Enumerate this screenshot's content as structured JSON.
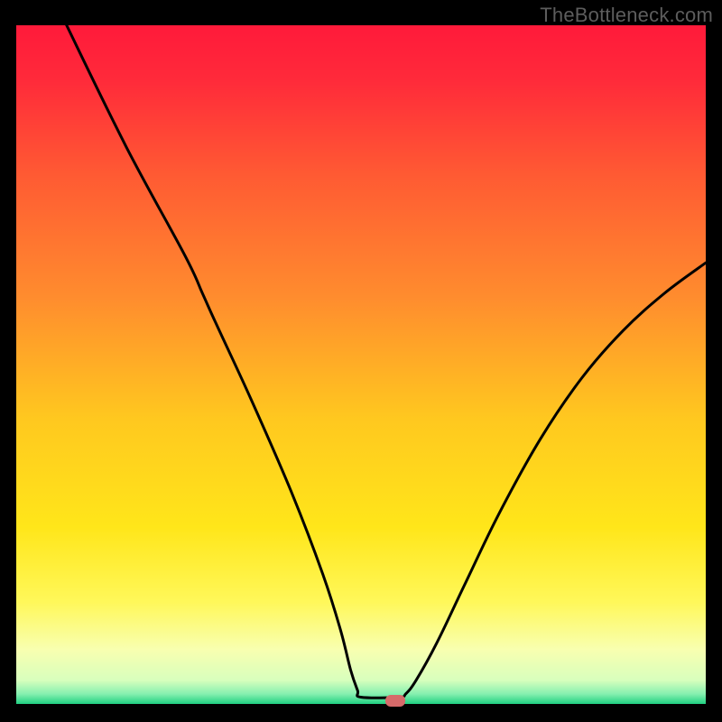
{
  "watermark": "TheBottleneck.com",
  "chart_data": {
    "type": "line",
    "title": "",
    "xlabel": "",
    "ylabel": "",
    "xlim": [
      0,
      100
    ],
    "ylim": [
      0,
      100
    ],
    "gradient_stops": [
      {
        "offset": 0.0,
        "color": "#ff1a3a"
      },
      {
        "offset": 0.08,
        "color": "#ff2a3a"
      },
      {
        "offset": 0.22,
        "color": "#ff5a33"
      },
      {
        "offset": 0.4,
        "color": "#ff8c2e"
      },
      {
        "offset": 0.58,
        "color": "#ffc81f"
      },
      {
        "offset": 0.74,
        "color": "#ffe61a"
      },
      {
        "offset": 0.85,
        "color": "#fff85a"
      },
      {
        "offset": 0.92,
        "color": "#f8ffb0"
      },
      {
        "offset": 0.965,
        "color": "#d8ffbd"
      },
      {
        "offset": 0.985,
        "color": "#87f0b0"
      },
      {
        "offset": 1.0,
        "color": "#20d082"
      }
    ],
    "series": [
      {
        "name": "bottleneck-curve",
        "points": [
          {
            "x": 7.3,
            "y": 100.0
          },
          {
            "x": 16.0,
            "y": 82.0
          },
          {
            "x": 24.5,
            "y": 66.0
          },
          {
            "x": 27.0,
            "y": 60.5
          },
          {
            "x": 29.0,
            "y": 56.0
          },
          {
            "x": 34.0,
            "y": 45.0
          },
          {
            "x": 40.0,
            "y": 31.0
          },
          {
            "x": 44.5,
            "y": 19.0
          },
          {
            "x": 47.0,
            "y": 11.0
          },
          {
            "x": 48.5,
            "y": 5.0
          },
          {
            "x": 49.5,
            "y": 2.0
          },
          {
            "x": 50.0,
            "y": 1.0
          },
          {
            "x": 55.5,
            "y": 1.0
          },
          {
            "x": 56.5,
            "y": 1.5
          },
          {
            "x": 58.0,
            "y": 3.5
          },
          {
            "x": 61.0,
            "y": 9.0
          },
          {
            "x": 65.0,
            "y": 17.5
          },
          {
            "x": 70.0,
            "y": 28.0
          },
          {
            "x": 76.0,
            "y": 39.0
          },
          {
            "x": 82.0,
            "y": 48.0
          },
          {
            "x": 88.0,
            "y": 55.0
          },
          {
            "x": 94.0,
            "y": 60.5
          },
          {
            "x": 100.0,
            "y": 65.0
          }
        ]
      }
    ],
    "marker": {
      "x": 55.0,
      "y": 0.5,
      "color": "#d66a6a"
    }
  }
}
